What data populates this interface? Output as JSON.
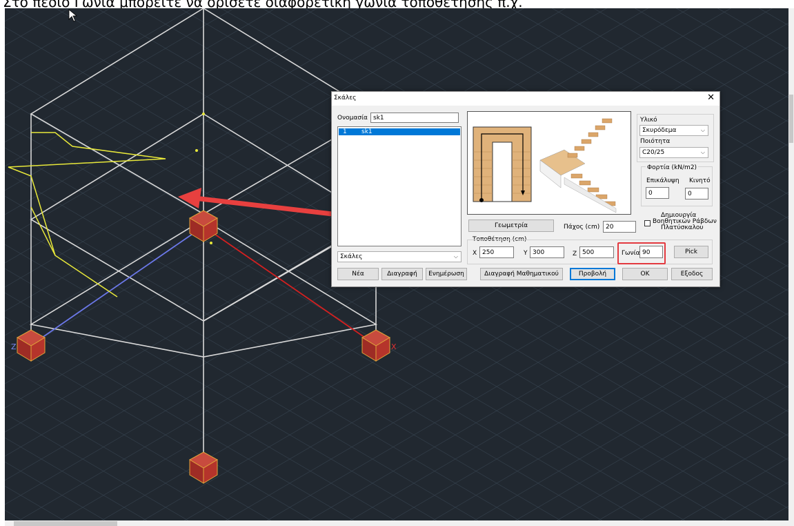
{
  "caption": "Στο πεδίο Γωνία μπορείτε να ορίσετε διαφορετική γωνία τοποθέτησης π.χ.",
  "axes": {
    "z": "Z",
    "x": "X"
  },
  "dialog": {
    "title": "Σκάλες",
    "close": "✕",
    "name_label": "Ονομασία",
    "name_value": "sk1",
    "list_items": [
      {
        "index": "1",
        "name": "sk1"
      }
    ],
    "type_combo": "Σκάλες",
    "geometry_button": "Γεωμετρία",
    "thickness_label": "Πάχος (cm)",
    "thickness_value": "20",
    "placement_label": "Τοποθέτηση (cm)",
    "x_label": "X",
    "x_value": "250",
    "y_label": "Y",
    "y_value": "300",
    "z_label": "Z",
    "z_value": "500",
    "angle_label": "Γωνία",
    "angle_value": "90",
    "pick_button": "Pick",
    "material_label": "Υλικό",
    "material_value": "Σκυρόδεμα",
    "quality_label": "Ποιότητα",
    "quality_value": "C20/25",
    "loads_label": "Φορτία (kN/m2)",
    "cover_label": "Επικάλυψη",
    "cover_value": "0",
    "live_label": "Κινητό",
    "live_value": "0",
    "aux_line1": "Δημιουργία",
    "aux_line2": "Βοηθητικών Ράβδων",
    "aux_line3": "Πλατύσκαλου",
    "buttons": {
      "new": "Νέα",
      "delete": "Διαγραφή",
      "update": "Ενημέρωση",
      "delete_math": "Διαγραφή Μαθηματικού",
      "view": "Προβολή",
      "ok": "OK",
      "exit": "Εξοδος"
    }
  },
  "colors": {
    "viewport_bg": "#212830",
    "highlight": "#e3393f",
    "arrow": "#e8403f",
    "selection": "#0078d7",
    "node_fill": "#b5342b",
    "stair_wood": "#e0b27a"
  }
}
